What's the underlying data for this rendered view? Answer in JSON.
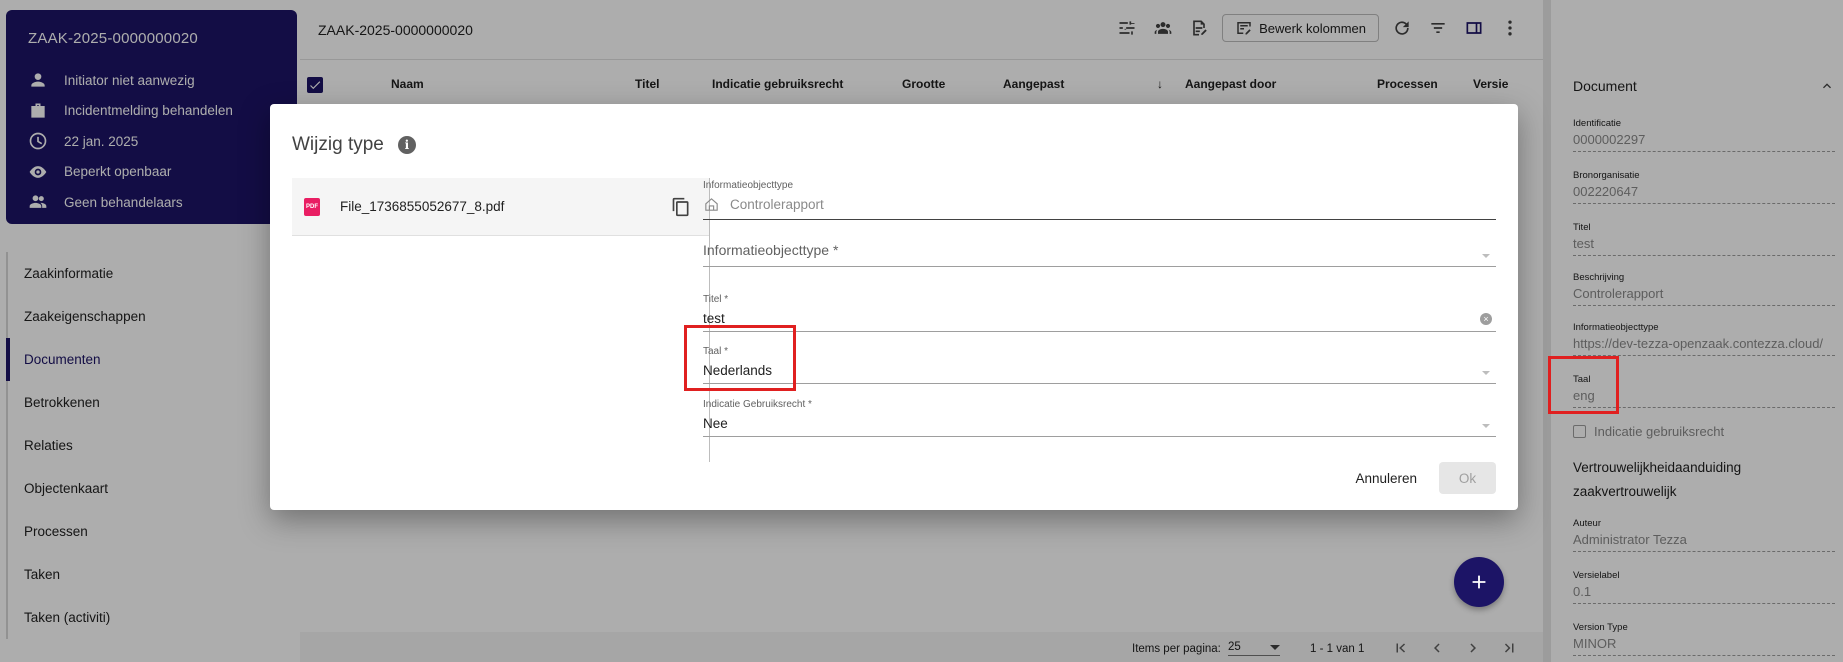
{
  "case_card": {
    "id": "ZAAK-2025-0000000020",
    "rows": [
      {
        "icon": "person-icon",
        "text": "Initiator niet aanwezig"
      },
      {
        "icon": "briefcase-icon",
        "text": "Incidentmelding behandelen"
      },
      {
        "icon": "clock-icon",
        "text": "22 jan. 2025"
      },
      {
        "icon": "eye-icon",
        "text": "Beperkt openbaar"
      },
      {
        "icon": "people-icon",
        "text": "Geen behandelaars"
      }
    ]
  },
  "nav": {
    "items": [
      "Zaakinformatie",
      "Zaakeigenschappen",
      "Documenten",
      "Betrokkenen",
      "Relaties",
      "Objectenkaart",
      "Processen",
      "Taken",
      "Taken (activiti)"
    ],
    "active": "Documenten"
  },
  "main": {
    "title": "ZAAK-2025-0000000020",
    "edit_columns_label": "Bewerk kolommen",
    "columns": {
      "naam": "Naam",
      "titel": "Titel",
      "indicatie": "Indicatie gebruiksrecht",
      "grootte": "Grootte",
      "aangepast": "Aangepast",
      "aangepast_door": "Aangepast door",
      "processen": "Processen",
      "versie": "Versie"
    }
  },
  "paginator": {
    "items_per_page_label": "Items per pagina:",
    "page_size": "25",
    "range": "1 - 1 van 1"
  },
  "dialog": {
    "title": "Wijzig type",
    "file": {
      "icon_text": "PDF",
      "name": "File_1736855052677_8.pdf"
    },
    "fields": {
      "current_type_label": "Informatieobjecttype",
      "current_type_value": "Controlerapport",
      "type_placeholder": "Informatieobjecttype *",
      "titel_label": "Titel *",
      "titel_value": "test",
      "taal_label": "Taal *",
      "taal_value": "Nederlands",
      "gebruiksrecht_label": "Indicatie Gebruiksrecht *",
      "gebruiksrecht_value": "Nee"
    },
    "cancel_label": "Annuleren",
    "ok_label": "Ok"
  },
  "document_panel": {
    "header": "Document",
    "fields": [
      {
        "label": "Identificatie",
        "value": "0000002297"
      },
      {
        "label": "Bronorganisatie",
        "value": "002220647"
      },
      {
        "label": "Titel",
        "value": "test"
      },
      {
        "label": "Beschrijving",
        "value": "Controlerapport"
      },
      {
        "label": "Informatieobjecttype",
        "value": "https://dev-tezza-openzaak.contezza.cloud/"
      },
      {
        "label": "Taal",
        "value": "eng"
      }
    ],
    "checkbox_label": "Indicatie gebruiksrecht",
    "confidentiality_label": "Vertrouwelijkheidaanduiding",
    "confidentiality_value": "zaakvertrouwelijk",
    "fields_bottom": [
      {
        "label": "Auteur",
        "value": "Administrator Tezza"
      },
      {
        "label": "Versielabel",
        "value": "0.1"
      },
      {
        "label": "Version Type",
        "value": "MINOR"
      }
    ]
  },
  "colors": {
    "brand": "#1c1466",
    "highlight": "#e02020"
  }
}
